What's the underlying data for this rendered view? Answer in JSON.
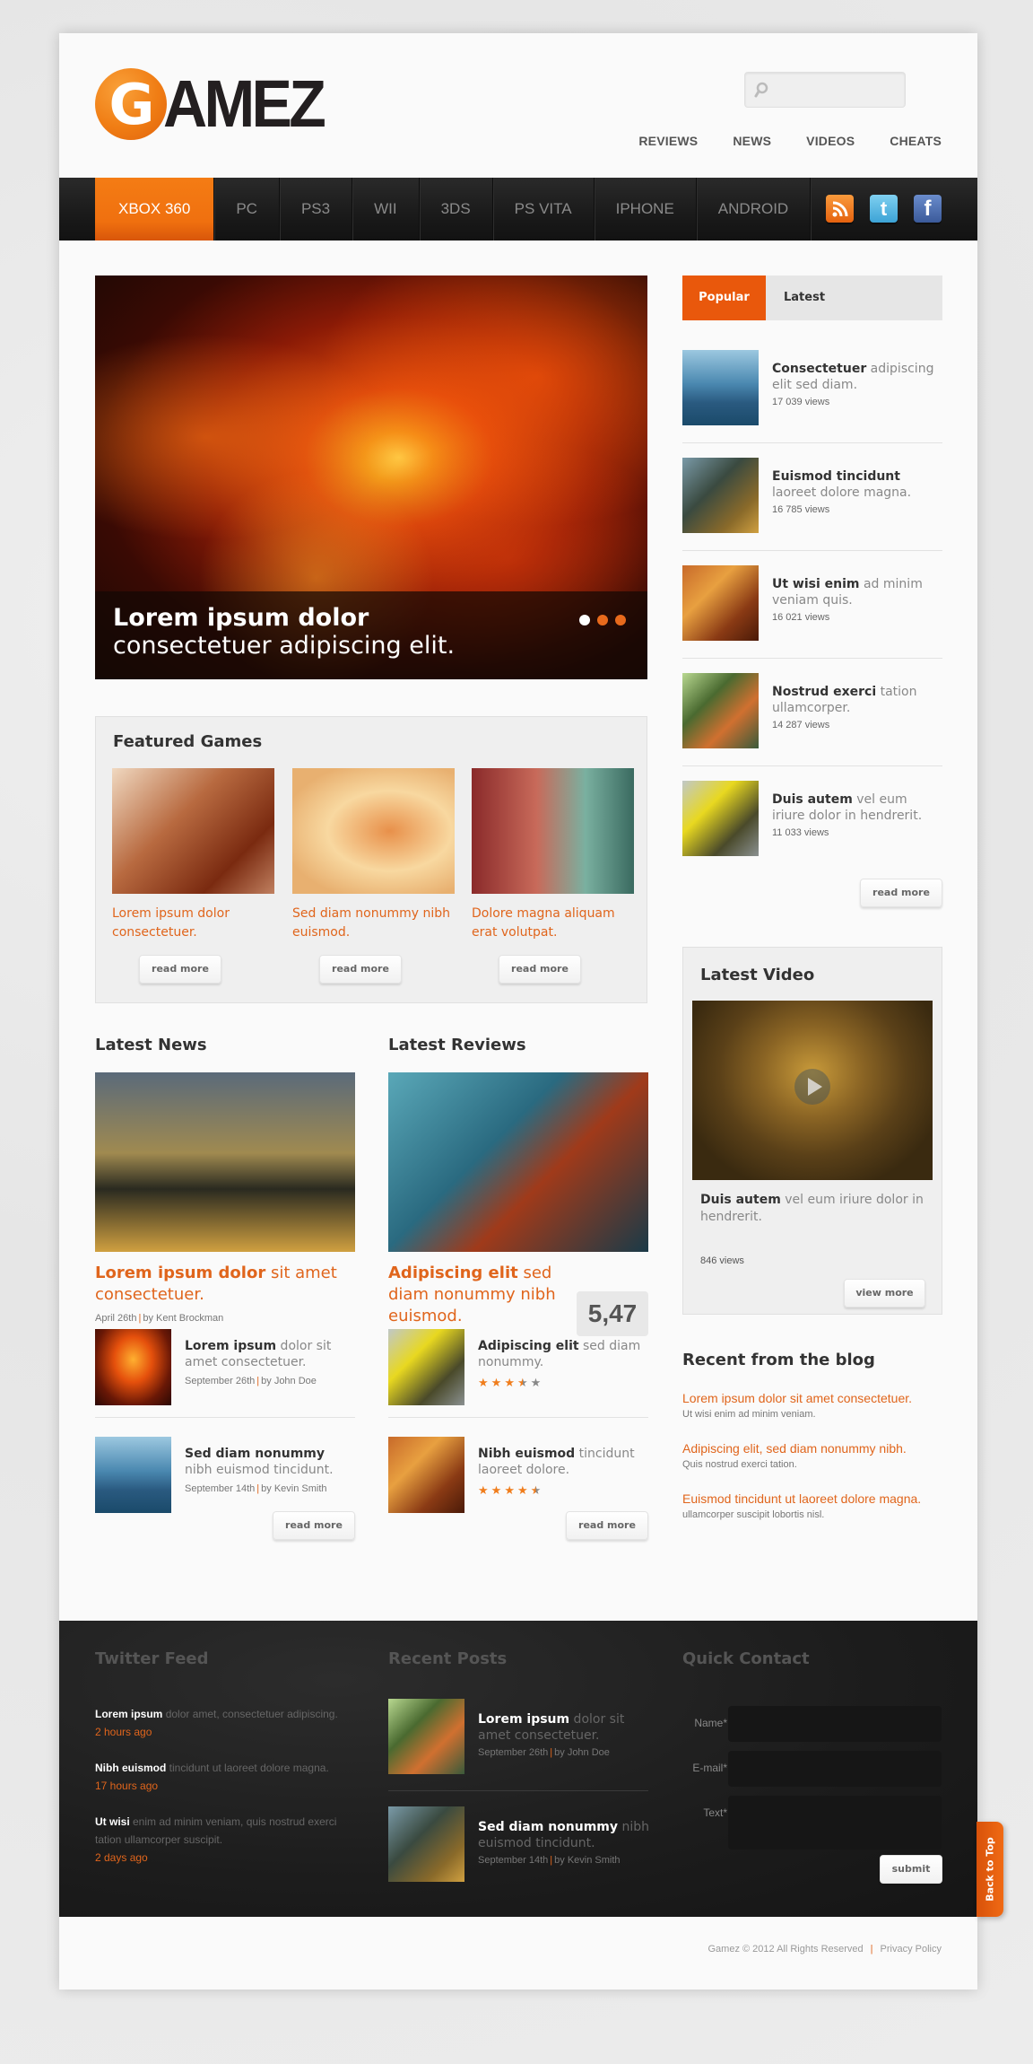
{
  "header": {
    "logo_initial": "G",
    "logo_rest": "AMEZ",
    "search_placeholder": "",
    "top_links": [
      "REVIEWS",
      "NEWS",
      "VIDEOS",
      "CHEATS"
    ]
  },
  "nav": {
    "items": [
      "XBOX 360",
      "PC",
      "PS3",
      "WII",
      "3DS",
      "PS VITA",
      "IPHONE",
      "ANDROID"
    ],
    "active": "XBOX 360",
    "social": [
      "rss-icon",
      "twitter-icon",
      "facebook-icon"
    ]
  },
  "colors": {
    "accent": "#e9580c",
    "dark": "#1f1f1f",
    "text_orange": "#e0651c"
  },
  "slider": {
    "caption_bold": "Lorem ipsum dolor",
    "caption_rest": " consectetuer adipiscing elit.",
    "slides_count": 3,
    "active_slide": 1
  },
  "featured": {
    "title": "Featured Games",
    "items": [
      {
        "title": "Lorem ipsum dolor consectetuer.",
        "button": "read more"
      },
      {
        "title": "Sed diam nonummy nibh euismod.",
        "button": "read more"
      },
      {
        "title": "Dolore magna aliquam erat volutpat.",
        "button": "read more"
      }
    ]
  },
  "news": {
    "title": "Latest News",
    "main": {
      "title_bold": "Lorem ipsum dolor",
      "title_rest": " sit amet consectetuer.",
      "date": "April 26th",
      "author": "by Kent Brockman"
    },
    "items": [
      {
        "bold": "Lorem ipsum",
        "rest": " dolor sit amet consectetuer.",
        "date": "September 26th",
        "author": "by John Doe"
      },
      {
        "bold": "Sed diam nonummy",
        "rest": " nibh euismod tincidunt.",
        "date": "September 14th",
        "author": "by Kevin Smith"
      }
    ],
    "button": "read more"
  },
  "reviews": {
    "title": "Latest Reviews",
    "main": {
      "title_bold": "Adipiscing elit",
      "title_rest": " sed diam nonummy nibh euismod.",
      "score": "5,47"
    },
    "items": [
      {
        "bold": "Adipiscing elit",
        "rest": " sed diam nonummy.",
        "rating": 3.5
      },
      {
        "bold": "Nibh euismod",
        "rest": " tincidunt laoreet dolore.",
        "rating": 4.5
      }
    ],
    "button": "read more"
  },
  "sidebar": {
    "tabs": [
      "Popular",
      "Latest"
    ],
    "active_tab": "Popular",
    "popular": [
      {
        "bold": "Consectetuer",
        "rest": " adipiscing elit sed diam.",
        "views": "17 039 views"
      },
      {
        "bold": "Euismod tincidunt",
        "rest": " laoreet dolore magna.",
        "views": "16 785 views"
      },
      {
        "bold": "Ut wisi enim",
        "rest": " ad minim veniam quis.",
        "views": "16 021 views"
      },
      {
        "bold": "Nostrud exerci",
        "rest": " tation ullamcorper.",
        "views": "14 287 views"
      },
      {
        "bold": "Duis autem",
        "rest": " vel eum iriure dolor in hendrerit.",
        "views": "11 033 views"
      }
    ],
    "button": "read more",
    "video": {
      "title": "Latest Video",
      "bold": "Duis autem",
      "rest": " vel eum iriure dolor in hendrerit.",
      "views": "846 views",
      "button": "view more"
    },
    "blog": {
      "title": "Recent from the blog",
      "items": [
        {
          "title": "Lorem ipsum dolor sit amet consectetuer.",
          "sub": "Ut wisi enim ad minim veniam."
        },
        {
          "title": "Adipiscing elit, sed diam nonummy nibh.",
          "sub": "Quis nostrud exerci tation."
        },
        {
          "title": "Euismod tincidunt ut laoreet dolore magna.",
          "sub": "ullamcorper suscipit lobortis nisl."
        }
      ]
    }
  },
  "footer": {
    "twitter": {
      "title": "Twitter Feed",
      "items": [
        {
          "bold": "Lorem ipsum",
          "rest": " dolor amet, consectetuer adipiscing.",
          "ago": "2 hours ago"
        },
        {
          "bold": "Nibh euismod",
          "rest": " tincidunt ut laoreet dolore magna.",
          "ago": "17 hours ago"
        },
        {
          "bold": "Ut wisi",
          "rest": " enim ad minim veniam, quis nostrud exerci tation ullamcorper suscipit.",
          "ago": "2 days ago"
        }
      ]
    },
    "recent": {
      "title": "Recent Posts",
      "items": [
        {
          "bold": "Lorem ipsum",
          "rest": " dolor sit amet consectetuer.",
          "date": "September 26th",
          "author": "by John Doe"
        },
        {
          "bold": "Sed diam nonummy",
          "rest": " nibh euismod tincidunt.",
          "date": "September 14th",
          "author": "by Kevin Smith"
        }
      ]
    },
    "contact": {
      "title": "Quick Contact",
      "labels": [
        "Name*",
        "E-mail*",
        "Text*"
      ],
      "values": [
        "",
        "",
        ""
      ],
      "submit": "submit"
    },
    "copyright": "Gamez © 2012 All Rights Reserved",
    "privacy": "Privacy Policy",
    "back_to_top": "Back to Top"
  }
}
